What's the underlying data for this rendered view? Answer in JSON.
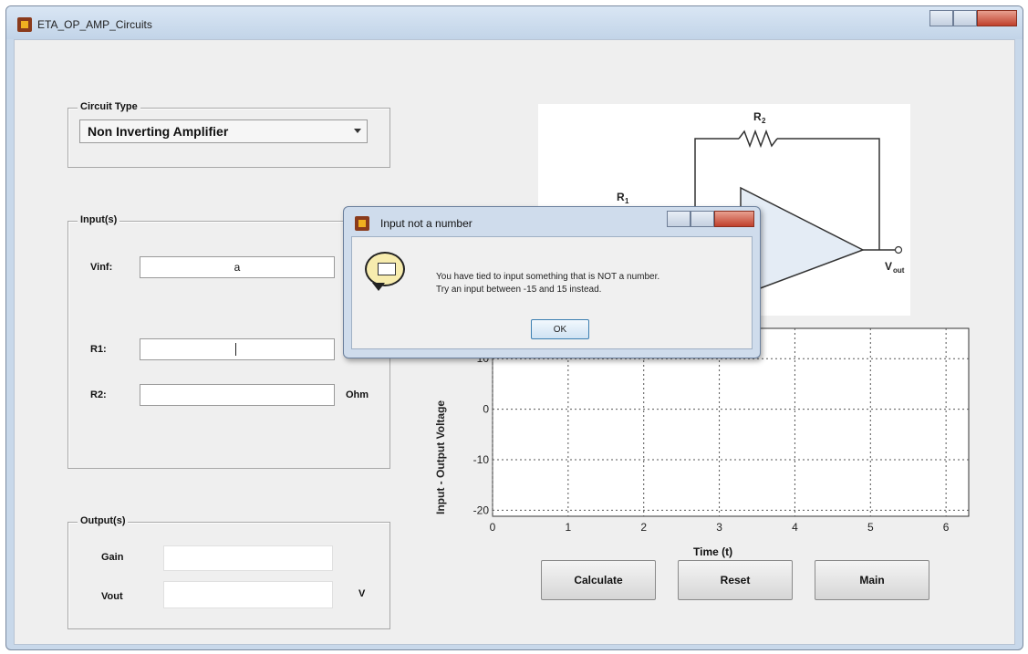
{
  "window": {
    "title": "ETA_OP_AMP_Circuits"
  },
  "circuit_type": {
    "label": "Circuit Type",
    "selected": "Non Inverting Amplifier"
  },
  "inputs": {
    "label": "Input(s)",
    "vin_label": "Vinf:",
    "vin_value": "a",
    "r1_label": "R1:",
    "r1_value": "",
    "r2_label": "R2:",
    "r2_value": "",
    "r2_unit": "Ohm"
  },
  "outputs": {
    "label": "Output(s)",
    "gain_label": "Gain",
    "gain_value": "",
    "vout_label": "Vout",
    "vout_value": "",
    "vout_unit": "V"
  },
  "schematic": {
    "r1": "R",
    "r1_sub": "1",
    "r2": "R",
    "r2_sub": "2",
    "vout": "V",
    "vout_sub": "out"
  },
  "plot": {
    "ylabel": "Input - Output Voltage",
    "xlabel": "Time (t)",
    "x_ticks": [
      "0",
      "1",
      "2",
      "3",
      "4",
      "5",
      "6"
    ],
    "y_ticks": [
      "10",
      "0",
      "-10",
      "-20"
    ]
  },
  "chart_data": {
    "type": "line",
    "xlabel": "Time (t)",
    "ylabel": "Input - Output Voltage",
    "xlim": [
      0,
      6
    ],
    "x_ticks": [
      0,
      1,
      2,
      3,
      4,
      5,
      6
    ],
    "y_ticks": [
      -20,
      -10,
      0,
      10
    ],
    "grid": true,
    "series": []
  },
  "buttons": {
    "calculate": "Calculate",
    "reset": "Reset",
    "main": "Main"
  },
  "dialog": {
    "title": "Input not a number",
    "line1": "You have tied to input something that is NOT a number.",
    "line2": "Try an input between -15 and 15 instead.",
    "ok": "OK"
  }
}
